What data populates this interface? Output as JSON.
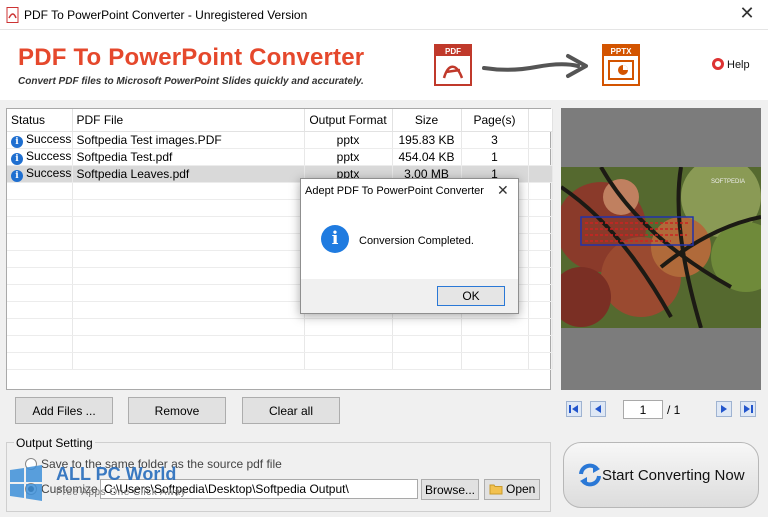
{
  "window": {
    "title": "PDF To PowerPoint Converter - Unregistered Version",
    "close_glyph": "✕"
  },
  "header": {
    "title": "PDF To PowerPoint Converter",
    "subtitle": "Convert PDF files to Microsoft PowerPoint Slides quickly and accurately.",
    "pdf_icon_label": "PDF",
    "pptx_icon_label": "PPTX",
    "help_label": "Help"
  },
  "table": {
    "columns": [
      "Status",
      "PDF File",
      "Output Format",
      "Size",
      "Page(s)"
    ],
    "rows": [
      {
        "status": "Success",
        "file": "Softpedia Test images.PDF",
        "format": "pptx",
        "size": "195.83 KB",
        "pages": "3",
        "selected": false
      },
      {
        "status": "Success",
        "file": "Softpedia Test.pdf",
        "format": "pptx",
        "size": "454.04 KB",
        "pages": "1",
        "selected": false
      },
      {
        "status": "Success",
        "file": "Softpedia Leaves.pdf",
        "format": "pptx",
        "size": "3.00 MB",
        "pages": "1",
        "selected": true
      }
    ]
  },
  "buttons": {
    "add_files": "Add Files ...",
    "remove": "Remove",
    "clear_all": "Clear all"
  },
  "preview": {
    "watermark_text": "SOFTPEDIA",
    "page_current": "1",
    "page_total": "/ 1"
  },
  "output": {
    "legend": "Output Setting",
    "same_folder_label": "Save to the same folder as the source pdf file",
    "customize_label": "Customize",
    "path_value": "C:\\Users\\Softpedia\\Desktop\\Softpedia Output\\",
    "browse": "Browse...",
    "open": "Open"
  },
  "start_button": "Start Converting Now",
  "dialog": {
    "title": "Adept PDF To PowerPoint Converter",
    "message": "Conversion Completed.",
    "ok": "OK",
    "icon_glyph": "i",
    "close_glyph": "✕"
  },
  "watermark": {
    "brand": "ALL PC World",
    "tagline": "Free Apps One Click Away"
  },
  "colors": {
    "brand_red": "#e5482c",
    "info_blue": "#1f7be0",
    "selection": "#d9d9d9"
  }
}
